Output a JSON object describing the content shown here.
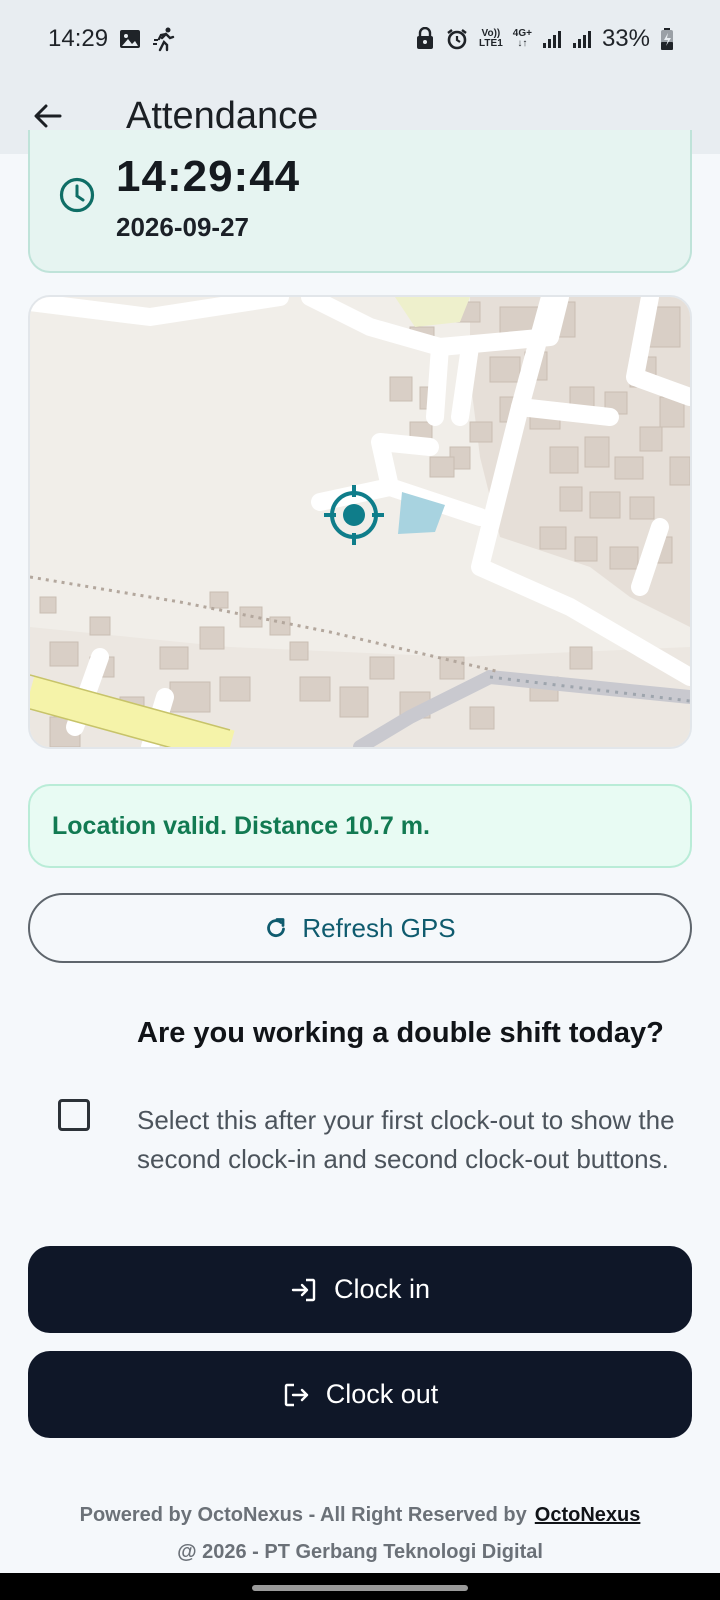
{
  "status_bar": {
    "time": "14:29",
    "left_icons": [
      "gallery-icon",
      "activity-icon"
    ],
    "right_icons": [
      "lock-icon",
      "alarm-icon",
      "volte-icon",
      "network-icon",
      "signal-icon",
      "signal-icon",
      "battery-icon"
    ],
    "volte_label_top": "Vo))",
    "volte_label_bottom": "LTE1",
    "network_label": "4G+",
    "battery": "33%"
  },
  "app_bar": {
    "title": "Attendance"
  },
  "clock": {
    "time": "14:29:44",
    "date": "2026-09-27"
  },
  "location": {
    "status": "Location valid. Distance 10.7 m."
  },
  "refresh": {
    "label": "Refresh GPS"
  },
  "double_shift": {
    "checked": false,
    "title": "Are you working a double shift today?",
    "description": "Select this after your first clock-out to show the second clock-in and second clock-out buttons."
  },
  "actions": {
    "clock_in": "Clock in",
    "clock_out": "Clock out"
  },
  "footer": {
    "line1": "Powered by OctoNexus - All Right Reserved by",
    "brand": "OctoNexus",
    "line2": "@ 2026 - PT Gerbang Teknologi Digital"
  },
  "colors": {
    "accent": "#0f7d8a",
    "success_text": "#127a52",
    "button_dark": "#0f1728"
  }
}
